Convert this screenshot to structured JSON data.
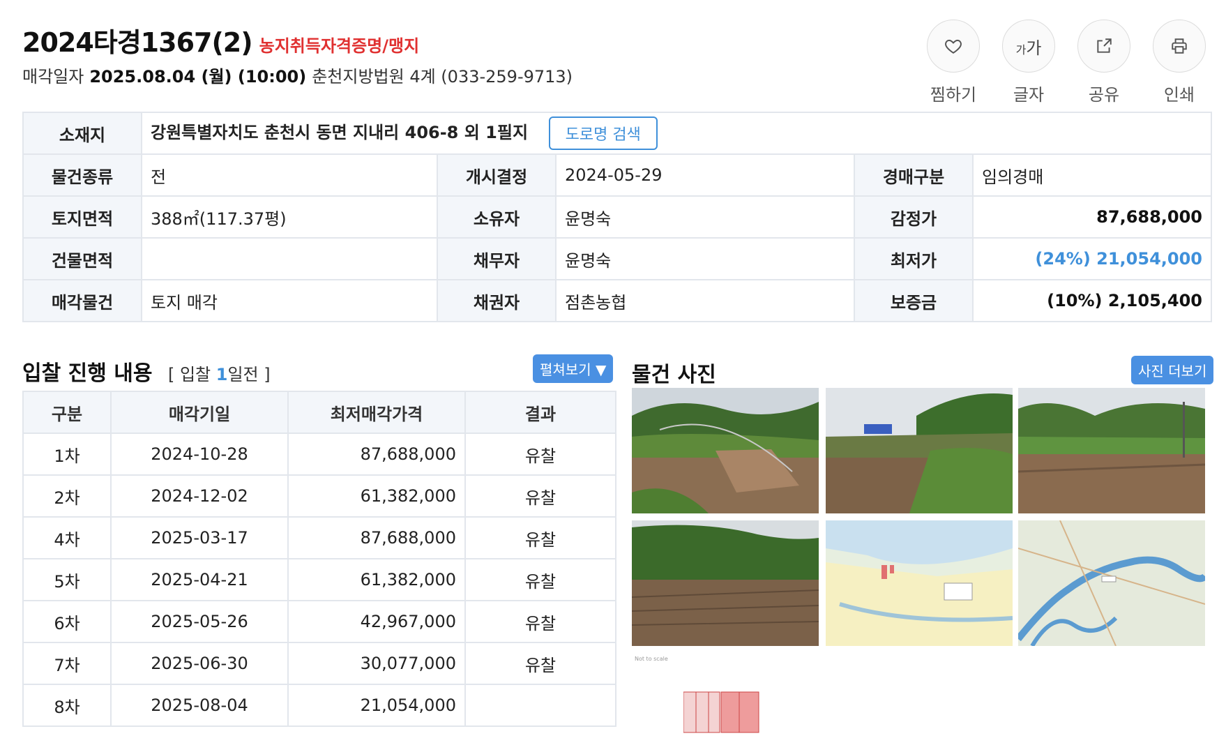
{
  "header": {
    "case_no": "2024타경1367(2)",
    "tag": "농지취득자격증명/맹지",
    "sale_label": "매각일자",
    "sale_datetime": "2025.08.04 (월) (10:00)",
    "court": "춘천지방법원 4계 (033-259-9713)"
  },
  "actions": [
    {
      "icon": "heart-icon",
      "label": "찜하기"
    },
    {
      "icon": "font-size-icon",
      "label": "글자",
      "glyph_small": "가",
      "glyph_large": "가"
    },
    {
      "icon": "share-icon",
      "label": "공유"
    },
    {
      "icon": "print-icon",
      "label": "인쇄"
    }
  ],
  "info": {
    "location_label": "소재지",
    "location": "강원특별자치도 춘천시 동면 지내리 406-8 외 1필지",
    "road_search": "도로명 검색",
    "rows": [
      {
        "k1": "물건종류",
        "v1": "전",
        "k2": "개시결정",
        "v2": "2024-05-29",
        "k3": "경매구분",
        "v3": "임의경매"
      },
      {
        "k1": "토지면적",
        "v1": "388㎡(117.37평)",
        "k2": "소유자",
        "v2": "윤명숙",
        "k3": "감정가",
        "v3": "87,688,000"
      },
      {
        "k1": "건물면적",
        "v1": "",
        "k2": "채무자",
        "v2": "윤명숙",
        "k3": "최저가",
        "v3": "(24%) 21,054,000"
      },
      {
        "k1": "매각물건",
        "v1": "토지 매각",
        "k2": "채권자",
        "v2": "점촌농협",
        "k3": "보증금",
        "v3": "(10%) 2,105,400"
      }
    ]
  },
  "bids": {
    "title": "입찰 진행 내용",
    "sub_open": "[ 입찰",
    "sub_num": "1",
    "sub_close": "일전 ]",
    "expand_btn": "펼쳐보기 ▼",
    "headers": [
      "구분",
      "매각기일",
      "최저매각가격",
      "결과"
    ],
    "rows": [
      [
        "1차",
        "2024-10-28",
        "87,688,000",
        "유찰"
      ],
      [
        "2차",
        "2024-12-02",
        "61,382,000",
        "유찰"
      ],
      [
        "4차",
        "2025-03-17",
        "87,688,000",
        "유찰"
      ],
      [
        "5차",
        "2025-04-21",
        "61,382,000",
        "유찰"
      ],
      [
        "6차",
        "2025-05-26",
        "42,967,000",
        "유찰"
      ],
      [
        "7차",
        "2025-06-30",
        "30,077,000",
        "유찰"
      ],
      [
        "8차",
        "2025-08-04",
        "21,054,000",
        ""
      ]
    ]
  },
  "photos": {
    "title": "물건 사진",
    "more_btn": "사진 더보기",
    "tiny_caption": "Not to scale",
    "items": [
      "field-photo",
      "field-photo",
      "field-photo",
      "field-photo",
      "cadastral-map",
      "region-map"
    ]
  },
  "colors": {
    "accent": "#3f90da",
    "tag_red": "#e03030",
    "button_blue": "#4a90e2"
  }
}
